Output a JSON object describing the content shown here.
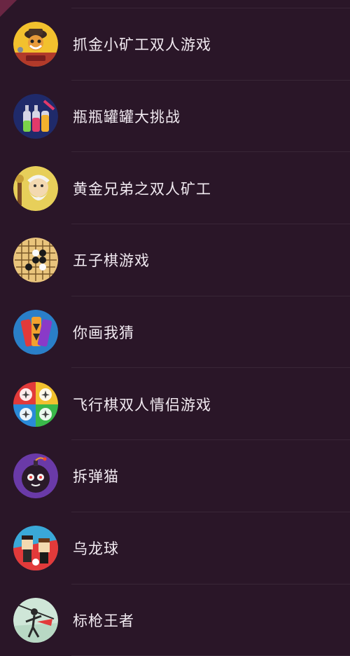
{
  "games": [
    {
      "title": "抓金小矿工双人游戏",
      "icon": "gold-miner-icon"
    },
    {
      "title": "瓶瓶罐罐大挑战",
      "icon": "bottles-icon"
    },
    {
      "title": "黄金兄弟之双人矿工",
      "icon": "old-miner-icon"
    },
    {
      "title": "五子棋游戏",
      "icon": "gomoku-board-icon"
    },
    {
      "title": "你画我猜",
      "icon": "draw-guess-icon"
    },
    {
      "title": "飞行棋双人情侣游戏",
      "icon": "ludo-planes-icon"
    },
    {
      "title": "拆弹猫",
      "icon": "bomb-cat-icon"
    },
    {
      "title": "乌龙球",
      "icon": "soccer-players-icon"
    },
    {
      "title": "标枪王者",
      "icon": "javelin-thrower-icon"
    }
  ],
  "colors": {
    "background": "#2a1628",
    "text": "#f1eaf1",
    "divider": "rgba(255,255,255,0.07)"
  }
}
